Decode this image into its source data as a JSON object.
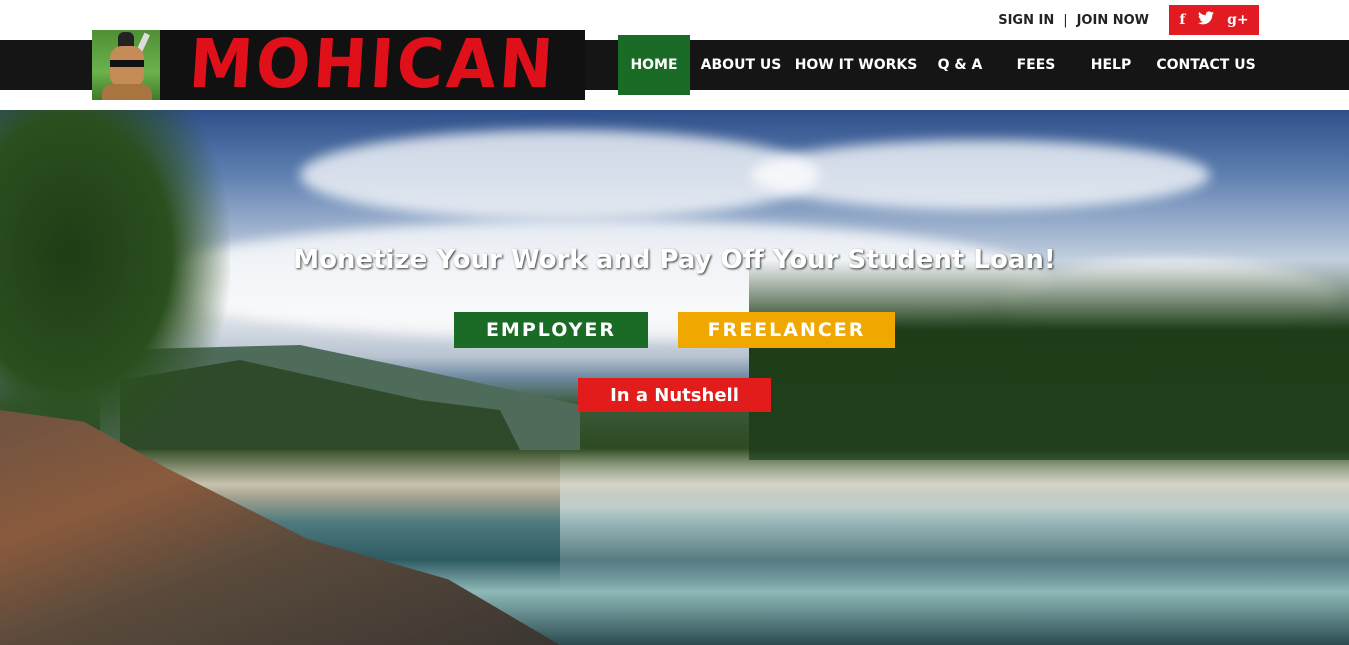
{
  "header": {
    "sign_in": "SIGN IN",
    "separator": "|",
    "join_now": "JOIN NOW",
    "social": {
      "facebook": "f",
      "twitter": "🐦",
      "googleplus": "g+"
    },
    "logo_text": "MOHICAN"
  },
  "nav": {
    "items": [
      {
        "label": "HOME",
        "active": true
      },
      {
        "label": "ABOUT US"
      },
      {
        "label": "HOW IT WORKS"
      },
      {
        "label": "Q & A"
      },
      {
        "label": "FEES"
      },
      {
        "label": "HELP"
      },
      {
        "label": "CONTACT US"
      }
    ]
  },
  "hero": {
    "headline": "Monetize Your Work and Pay Off Your Student Loan!",
    "employer_label": "EMPLOYER",
    "freelancer_label": "FREELANCER",
    "nutshell_label": "In a Nutshell"
  },
  "colors": {
    "nav_bg": "#151515",
    "active_green": "#1a6b25",
    "social_red": "#e21b23",
    "freelancer_yellow": "#f0a800",
    "nutshell_red": "#e21b1b",
    "logo_red": "#e0101a"
  }
}
